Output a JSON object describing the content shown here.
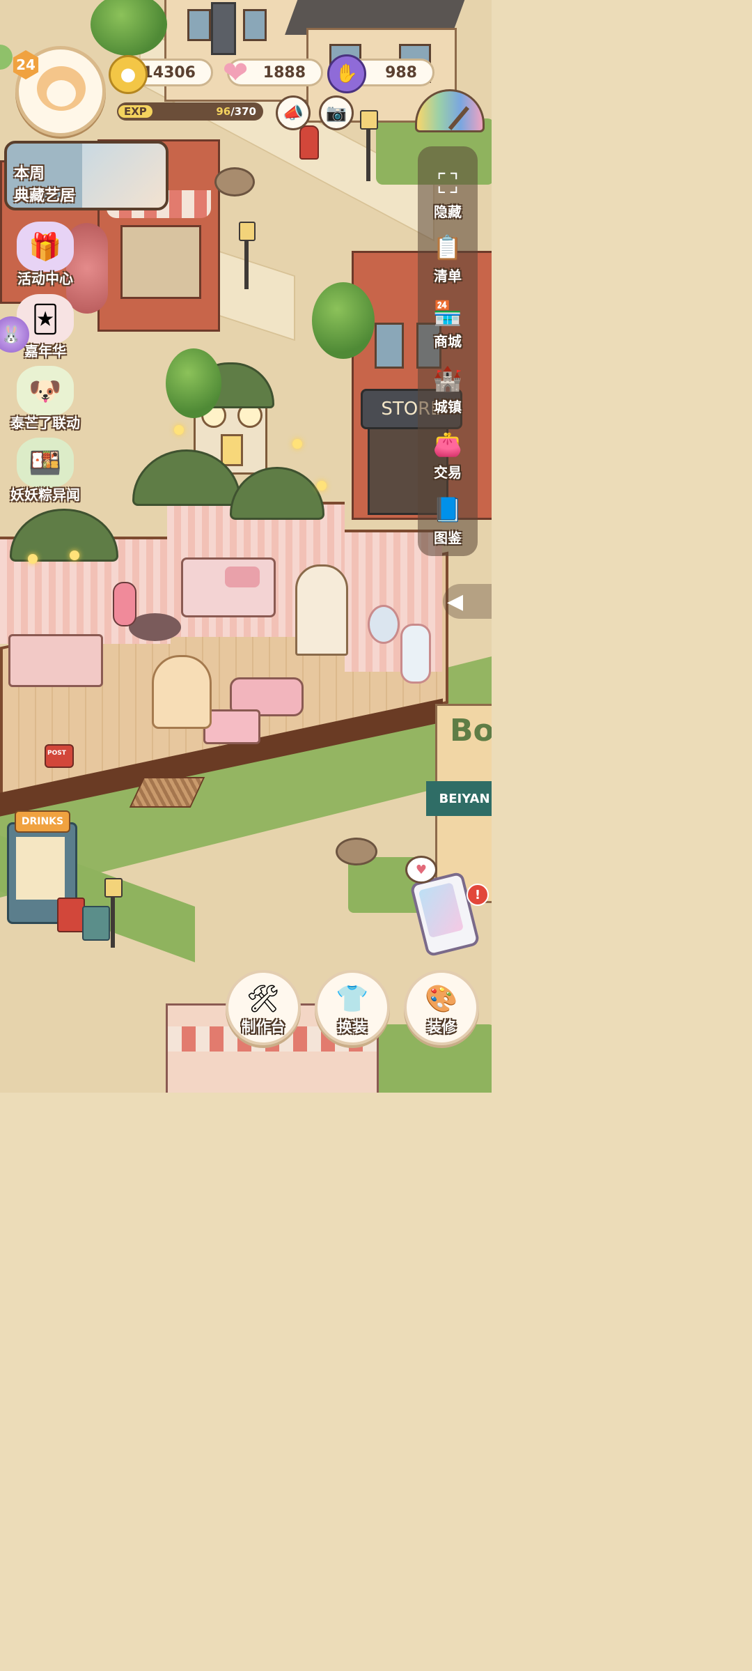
{
  "hud": {
    "level": "24",
    "coins": "14306",
    "hearts": "1888",
    "gems": "988",
    "exp_label": "EXP",
    "exp_current": "96",
    "exp_total": "/370",
    "exp_progress": 0.26,
    "weekly_title_line1": "本周",
    "weekly_title_line2": "典藏艺居"
  },
  "left_events": [
    {
      "label": "活动中心",
      "icon": "gift-icon"
    },
    {
      "label": "嘉年华",
      "icon": "jester-hat-icon"
    },
    {
      "label": "泰芒了联动",
      "icon": "collab-character-icon"
    },
    {
      "label": "妖妖粽异闻",
      "icon": "zongzi-icon"
    }
  ],
  "right_menu": [
    {
      "label": "隐藏",
      "icon": "fullscreen-icon"
    },
    {
      "label": "清单",
      "icon": "checklist-icon"
    },
    {
      "label": "商城",
      "icon": "shop-icon"
    },
    {
      "label": "城镇",
      "icon": "castle-icon"
    },
    {
      "label": "交易",
      "icon": "trade-wallet-icon"
    },
    {
      "label": "图鉴",
      "icon": "album-book-icon"
    }
  ],
  "bottom_actions": [
    {
      "label": "制作台",
      "icon": "workbench-icon"
    },
    {
      "label": "换装",
      "icon": "outfit-icon"
    },
    {
      "label": "装修",
      "icon": "paint-roller-icon"
    }
  ],
  "signs": {
    "store": "STORE",
    "drinks": "DRINKS",
    "post": "POST",
    "beiyan": "BEIYAN",
    "bo": "Bo"
  },
  "colors": {
    "coin": "#f3c646",
    "heart": "#f2a1b7",
    "gem": "#8f6bd8",
    "hud_border": "#cdb58f",
    "text_outline": "#5a3e2b"
  }
}
